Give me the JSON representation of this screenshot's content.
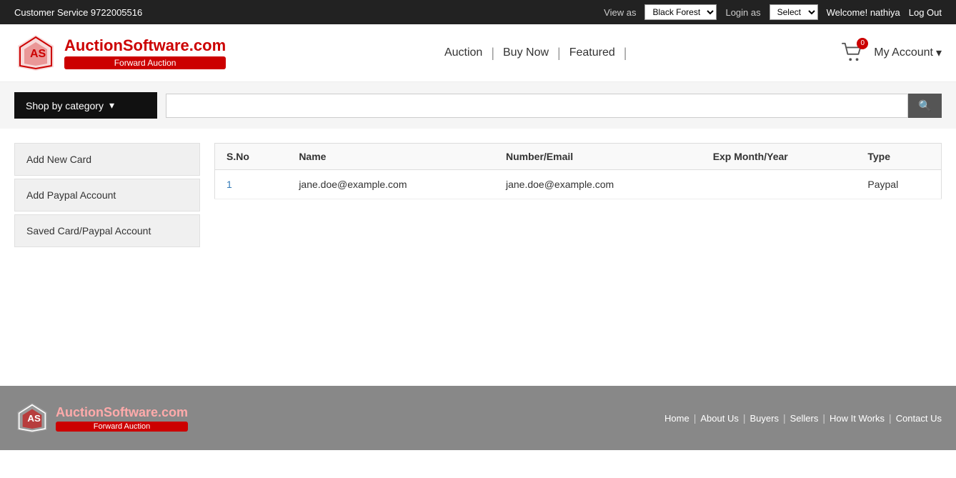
{
  "topbar": {
    "customer_service_label": "Customer Service 9722005516",
    "view_as_label": "View as",
    "view_as_value": "Black Forest",
    "login_as_label": "Login as",
    "login_as_value": "Select",
    "welcome_text": "Welcome!",
    "username": "nathiya",
    "logout_label": "Log Out"
  },
  "header": {
    "logo_brand": "AuctionSoftware.com",
    "logo_sub": "Forward Auction",
    "nav_items": [
      {
        "label": "Auction",
        "id": "auction"
      },
      {
        "label": "Buy Now",
        "id": "buy-now"
      },
      {
        "label": "Featured",
        "id": "featured"
      }
    ],
    "cart_count": "0",
    "my_account_label": "My Account"
  },
  "search": {
    "shop_by_category_label": "Shop by category",
    "search_placeholder": "",
    "search_icon": "🔍"
  },
  "sidebar": {
    "items": [
      {
        "label": "Add New Card",
        "id": "add-new-card"
      },
      {
        "label": "Add Paypal Account",
        "id": "add-paypal"
      },
      {
        "label": "Saved Card/Paypal Account",
        "id": "saved-card"
      }
    ]
  },
  "table": {
    "columns": [
      "S.No",
      "Name",
      "Number/Email",
      "Exp Month/Year",
      "Type"
    ],
    "rows": [
      {
        "sno": "1",
        "name": "jane.doe@example.com",
        "number_email": "jane.doe@example.com",
        "exp_month_year": "",
        "type": "Paypal"
      }
    ]
  },
  "footer": {
    "logo_brand": "AuctionSoftware.com",
    "logo_sub": "Forward Auction",
    "nav_items": [
      {
        "label": "Home",
        "id": "home"
      },
      {
        "label": "About Us",
        "id": "about"
      },
      {
        "label": "Buyers",
        "id": "buyers"
      },
      {
        "label": "Sellers",
        "id": "sellers"
      },
      {
        "label": "How It Works",
        "id": "how-it-works"
      },
      {
        "label": "Contact Us",
        "id": "contact"
      }
    ]
  }
}
